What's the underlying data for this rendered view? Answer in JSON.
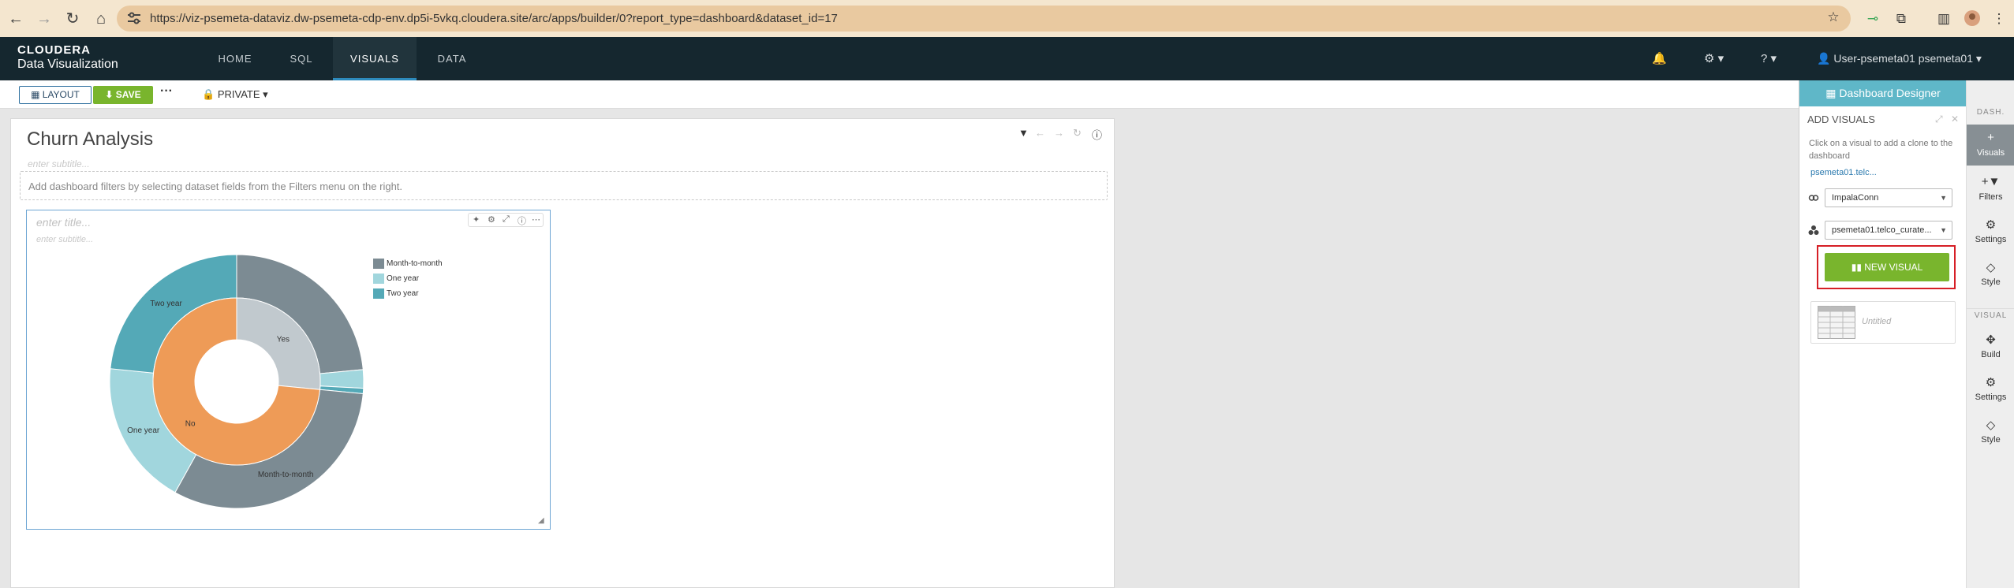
{
  "browser": {
    "url": "https://viz-psemeta-dataviz.dw-psemeta-cdp-env.dp5i-5vkq.cloudera.site/arc/apps/builder/0?report_type=dashboard&dataset_id=17"
  },
  "app": {
    "logo_top": "CLOUDERA",
    "logo_bottom": "Data Visualization",
    "nav": [
      {
        "label": "HOME"
      },
      {
        "label": "SQL"
      },
      {
        "label": "VISUALS",
        "active": true
      },
      {
        "label": "DATA"
      }
    ],
    "user": "User-psemeta01 psemeta01"
  },
  "toolbar": {
    "layout_label": "LAYOUT",
    "save_label": "SAVE",
    "more_label": "···",
    "private_label": "PRIVATE"
  },
  "dashboard": {
    "title": "Churn Analysis",
    "subtitle_placeholder": "enter subtitle...",
    "filter_hint": "Add dashboard filters by selecting dataset fields from the Filters menu on the right."
  },
  "visual": {
    "title_placeholder": "enter title...",
    "subtitle_placeholder": "enter subtitle..."
  },
  "chart_data": {
    "type": "pie",
    "variant": "nested-donut",
    "legend": [
      "Month-to-month",
      "One year",
      "Two year"
    ],
    "legend_placement": "top-right",
    "colors": {
      "Month-to-month": "#7c8b93",
      "One year": "#a1d6dd",
      "Two year": "#54a9b7",
      "Yes": "#c1c9ce",
      "No": "#ee9b57"
    },
    "inner_ring": [
      {
        "label": "Yes",
        "value": 1869
      },
      {
        "label": "No",
        "value": 5174
      }
    ],
    "outer_ring": [
      {
        "parent": "Yes",
        "contract": "Month-to-month",
        "value": 1655
      },
      {
        "parent": "Yes",
        "contract": "One year",
        "value": 166
      },
      {
        "parent": "Yes",
        "contract": "Two year",
        "value": 48
      },
      {
        "parent": "No",
        "contract": "Month-to-month",
        "value": 2220
      },
      {
        "parent": "No",
        "contract": "One year",
        "value": 1307
      },
      {
        "parent": "No",
        "contract": "Two year",
        "value": 1647
      }
    ],
    "outer_labels": [
      {
        "text": "Month-to-month",
        "ref": 3
      },
      {
        "text": "One year",
        "ref": 4
      },
      {
        "text": "Two year",
        "ref": 5
      }
    ],
    "inner_labels": [
      {
        "text": "Yes",
        "ref": 0
      },
      {
        "text": "No",
        "ref": 1
      }
    ]
  },
  "panel": {
    "header": "Dashboard Designer",
    "section_title": "ADD VISUALS",
    "hint": "Click on a visual to add a clone to the dashboard",
    "dataset_link": "psemeta01.telc...",
    "connection": "ImpalaConn",
    "dataset": "psemeta01.telco_curate...",
    "new_visual_label": "NEW VISUAL",
    "visual_card_title": "Untitled"
  },
  "sidebar": {
    "dash_section": "DASH.",
    "visual_section": "VISUAL",
    "dash_items": [
      {
        "label": "Visuals",
        "icon": "+",
        "active": true
      },
      {
        "label": "Filters",
        "icon": "+▼"
      },
      {
        "label": "Settings",
        "icon": "⚙"
      },
      {
        "label": "Style",
        "icon": "◇"
      }
    ],
    "visual_items": [
      {
        "label": "Build",
        "icon": "✥"
      },
      {
        "label": "Settings",
        "icon": "⚙"
      },
      {
        "label": "Style",
        "icon": "◇"
      }
    ]
  }
}
